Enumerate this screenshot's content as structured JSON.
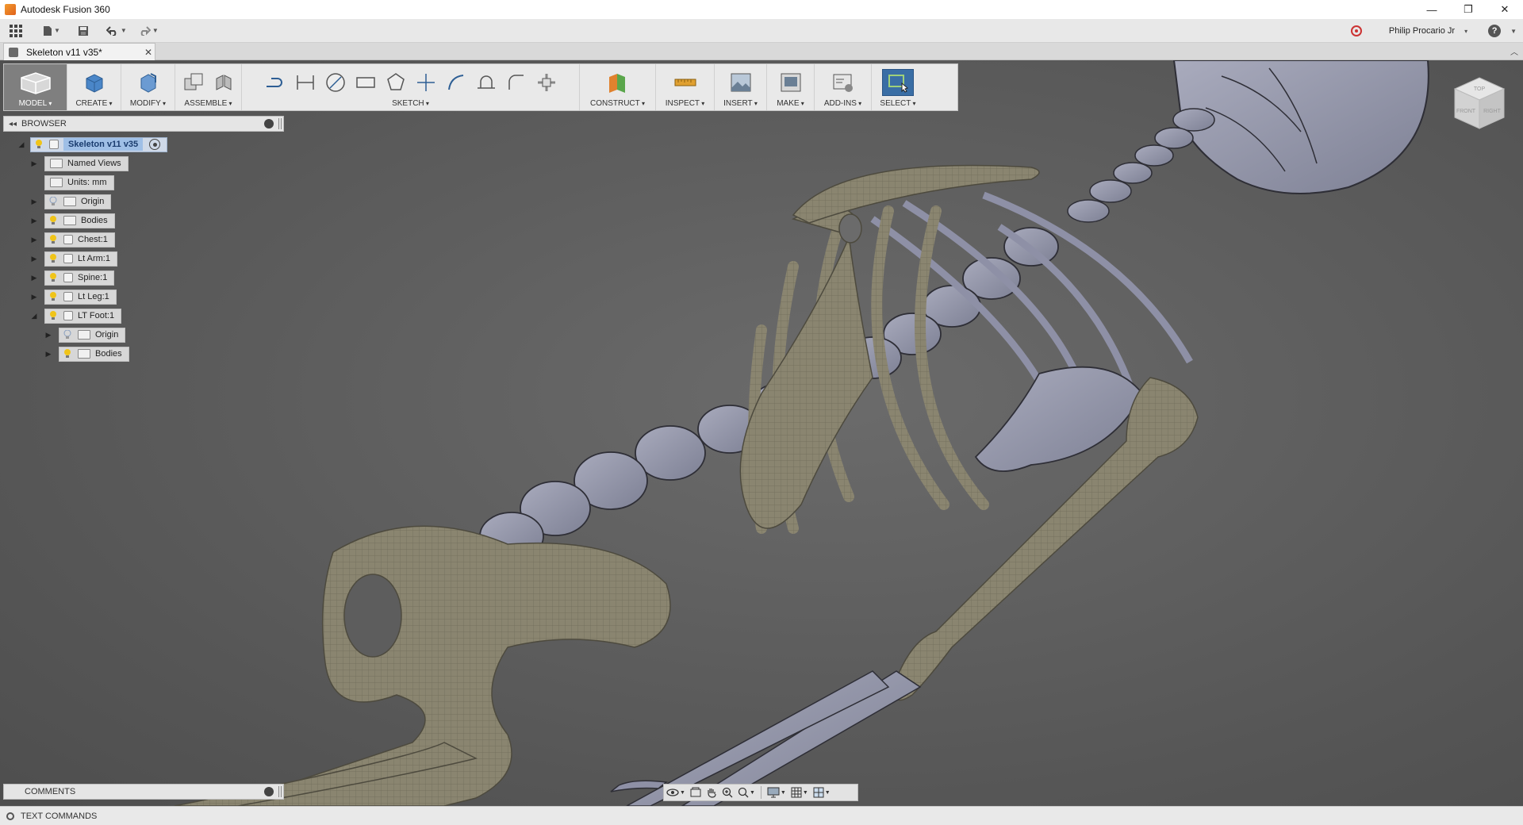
{
  "window": {
    "title": "Autodesk Fusion 360",
    "minimize": "—",
    "restore": "❐",
    "close": "✕"
  },
  "quick_access": {
    "user_name": "Philip Procario Jr",
    "user_caret": "▾",
    "help": "?"
  },
  "document_tab": {
    "label": "Skeleton v11 v35*",
    "close": "✕",
    "collapse": "︿"
  },
  "toolbar": {
    "groups": [
      {
        "label": "MODEL"
      },
      {
        "label": "CREATE"
      },
      {
        "label": "MODIFY"
      },
      {
        "label": "ASSEMBLE"
      },
      {
        "label": "SKETCH"
      },
      {
        "label": "CONSTRUCT"
      },
      {
        "label": "INSPECT"
      },
      {
        "label": "INSERT"
      },
      {
        "label": "MAKE"
      },
      {
        "label": "ADD-INS"
      },
      {
        "label": "SELECT"
      }
    ]
  },
  "browser": {
    "title": "BROWSER",
    "root": "Skeleton v11 v35",
    "items": [
      {
        "label": "Named Views"
      },
      {
        "label": "Units: mm"
      },
      {
        "label": "Origin"
      },
      {
        "label": "Bodies"
      },
      {
        "label": "Chest:1"
      },
      {
        "label": "Lt Arm:1"
      },
      {
        "label": "Spine:1"
      },
      {
        "label": "Lt Leg:1"
      },
      {
        "label": "LT Foot:1"
      },
      {
        "label": "Origin"
      },
      {
        "label": "Bodies"
      }
    ]
  },
  "comments": {
    "title": "COMMENTS"
  },
  "text_commands": {
    "label": "TEXT COMMANDS"
  },
  "viewcube": {
    "top": "TOP",
    "front": "FRONT",
    "right": "RIGHT"
  },
  "colors": {
    "viewport_bg": "#5a5a5a",
    "bone_tan": "#8a8570",
    "bone_gray": "#8e90a6",
    "accent_blue": "#3a6ea5"
  }
}
